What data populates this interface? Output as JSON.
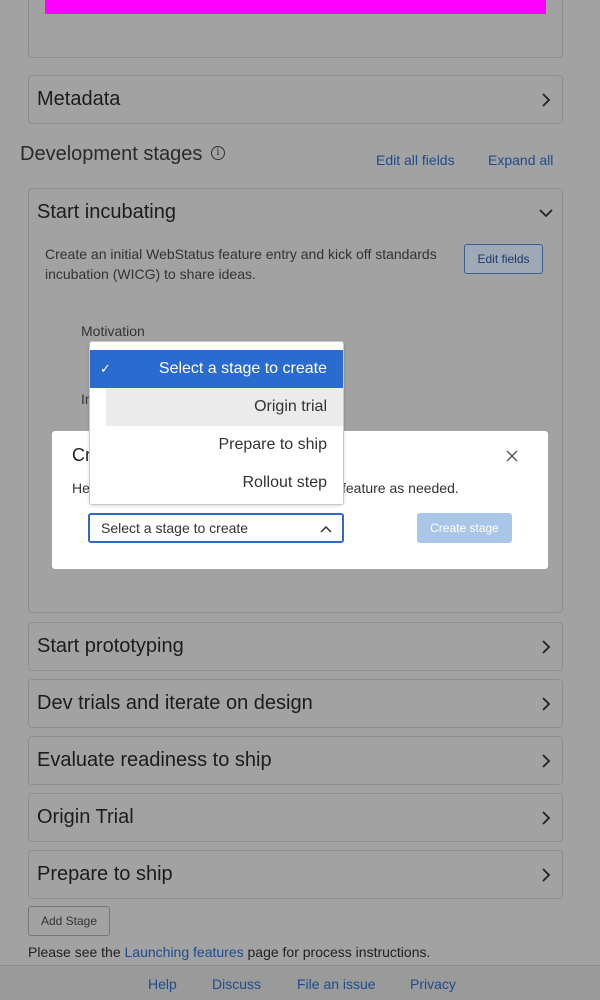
{
  "metadata": {
    "title": "Metadata"
  },
  "dev_stages": {
    "title": "Development stages",
    "edit_all": "Edit all fields",
    "expand_all": "Expand all"
  },
  "incubating": {
    "title": "Start incubating",
    "description": "Create an initial WebStatus feature entry and kick off standards incubation (WICG) to share ideas.",
    "edit_fields": "Edit fields",
    "motivation_label": "Motivation",
    "initial_label": "In"
  },
  "dialog": {
    "title_visible": "Cr",
    "help_left": "He",
    "help_right": "feature as needed.",
    "select_value": "Select a stage to create",
    "create_button": "Create stage"
  },
  "dropdown": {
    "options": [
      "Select a stage to create",
      "Origin trial",
      "Prepare to ship",
      "Rollout step"
    ]
  },
  "collapsed_sections": [
    "Start prototyping",
    "Dev trials and iterate on design",
    "Evaluate readiness to ship",
    "Origin Trial",
    "Prepare to ship"
  ],
  "add_stage": "Add Stage",
  "process_note": {
    "before": "Please see the ",
    "link": "Launching features",
    "after": " page for process instructions."
  },
  "footer": {
    "help": "Help",
    "discuss": "Discuss",
    "file_issue": "File an issue",
    "privacy": "Privacy"
  },
  "colors": {
    "accent": "#2a6bd0",
    "magenta": "#ff00ff",
    "link": "#1c4c8e"
  },
  "icons": {
    "collapsed": "chevron-right-icon",
    "expanded": "chevron-down-icon",
    "info": "info-icon",
    "close": "close-icon"
  }
}
